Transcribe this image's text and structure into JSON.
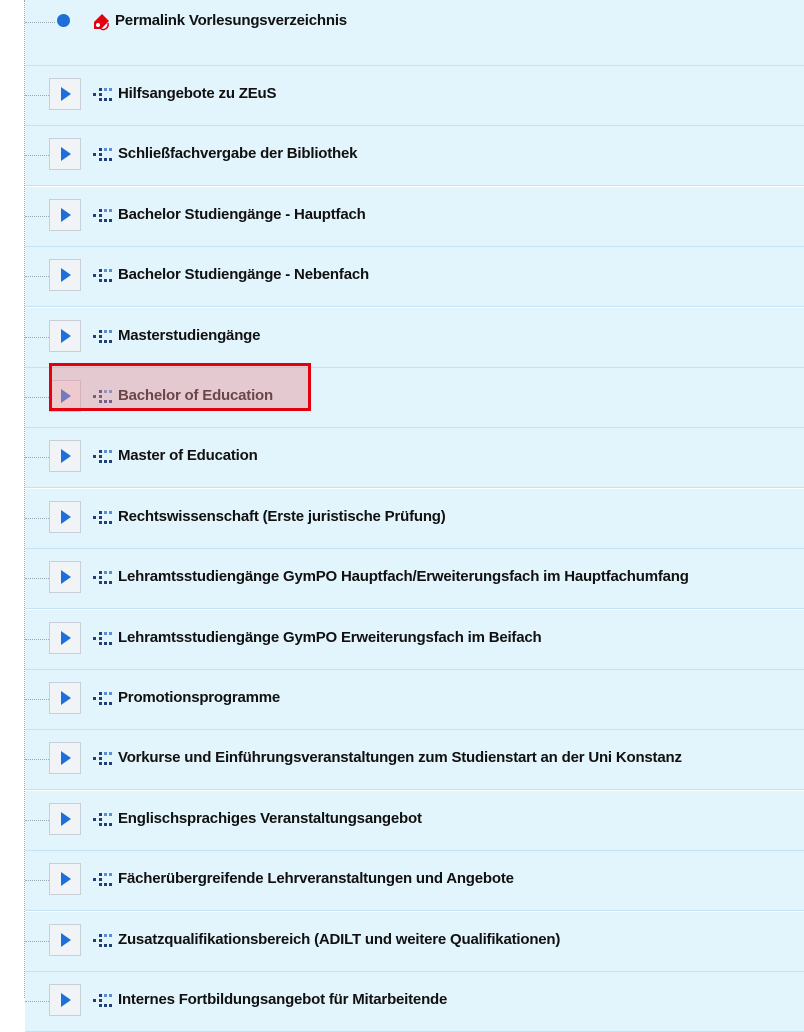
{
  "tree": {
    "root": {
      "label": "Permalink Vorlesungsverzeichnis",
      "icon": "tag-icon"
    },
    "items": [
      {
        "label": "Hilfsangebote zu ZEuS"
      },
      {
        "label": "Schließfachvergabe der Bibliothek"
      },
      {
        "label": "Bachelor Studiengänge - Hauptfach"
      },
      {
        "label": "Bachelor Studiengänge - Nebenfach"
      },
      {
        "label": "Masterstudiengänge"
      },
      {
        "label": "Bachelor of Education",
        "highlighted": true
      },
      {
        "label": "Master of Education"
      },
      {
        "label": "Rechtswissenschaft (Erste juristische Prüfung)"
      },
      {
        "label": "Lehramtsstudiengänge GymPO Hauptfach/Erweiterungsfach im Hauptfachumfang"
      },
      {
        "label": "Lehramtsstudiengänge GymPO Erweiterungsfach im Beifach"
      },
      {
        "label": "Promotionsprogramme"
      },
      {
        "label": "Vorkurse und Einführungsveranstaltungen zum Studienstart an der Uni Konstanz"
      },
      {
        "label": "Englischsprachiges Veranstaltungsangebot"
      },
      {
        "label": "Fächerübergreifende Lehrveranstaltungen und Angebote"
      },
      {
        "label": "Zusatzqualifikationsbereich (ADILT und weitere Qualifikationen)"
      },
      {
        "label": "Internes Fortbildungsangebot für Mitarbeitende"
      }
    ]
  },
  "colors": {
    "row_background": "#e2f4fc",
    "chevron": "#1e6fd9",
    "bullet": "#1e6fd9",
    "tag_icon": "#e3000f",
    "highlight_border": "#e3000f"
  },
  "icons": {
    "expander": "chevron-right-icon",
    "node": "dot-grid-icon",
    "bullet": "bullet-icon",
    "permalink": "tag-icon"
  }
}
